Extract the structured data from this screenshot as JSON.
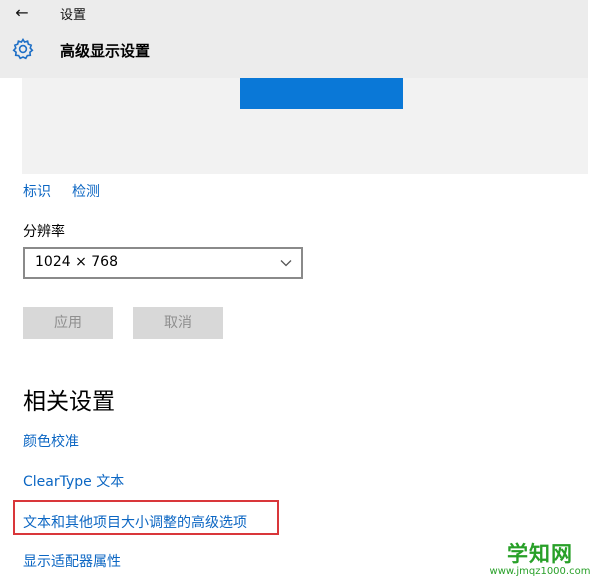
{
  "window": {
    "title": "设置",
    "back_icon": "back-arrow-icon"
  },
  "page": {
    "title": "高级显示设置",
    "icon": "gear-icon"
  },
  "display": {
    "identify_link": "标识",
    "detect_link": "检测",
    "resolution_label": "分辨率",
    "resolution_value": "1024 × 768",
    "apply_button": "应用",
    "cancel_button": "取消"
  },
  "related": {
    "title": "相关设置",
    "links": [
      "颜色校准",
      "ClearType 文本",
      "文本和其他项目大小调整的高级选项",
      "显示适配器属性"
    ]
  },
  "watermark": {
    "name": "学知网",
    "url": "www.jmqz1000.com"
  },
  "colors": {
    "accent": "#0b66c3",
    "monitor": "#0a78d7",
    "highlight": "#d9363a",
    "watermark": "#28a028"
  }
}
